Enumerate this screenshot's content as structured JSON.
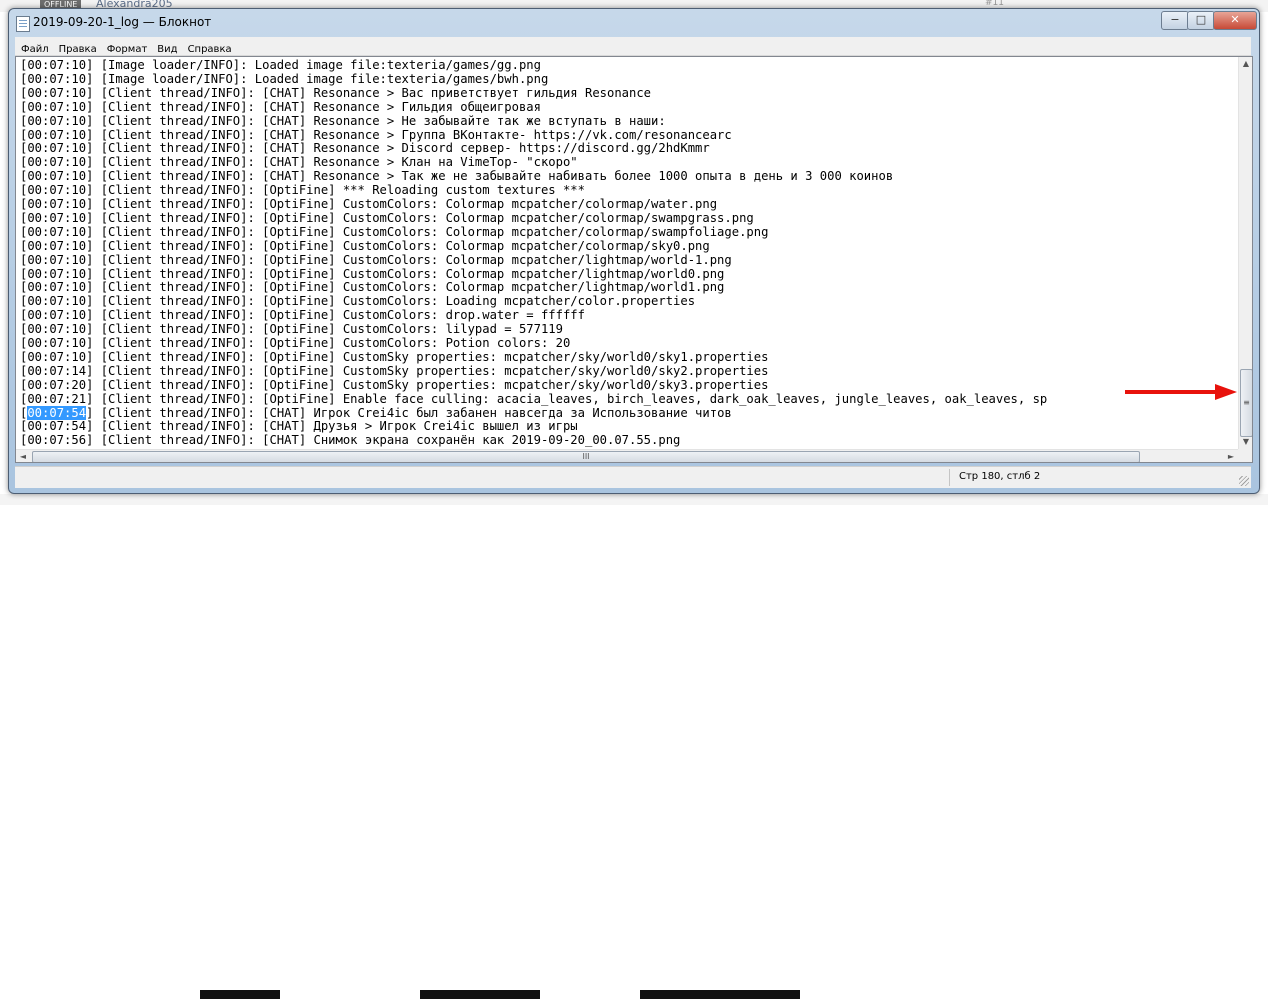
{
  "background": {
    "tag": "OFFLINE",
    "username": "Alexandra205",
    "post_number": "#11"
  },
  "window": {
    "title": "2019-09-20-1_log — Блокнот",
    "controls": {
      "minimize": "−",
      "maximize": "□",
      "close": "✕"
    }
  },
  "menu": [
    "Файл",
    "Правка",
    "Формат",
    "Вид",
    "Справка"
  ],
  "log_lines": [
    "[00:07:10] [Image loader/INFO]: Loaded image file:texteria/games/gg.png",
    "[00:07:10] [Image loader/INFO]: Loaded image file:texteria/games/bwh.png",
    "[00:07:10] [Client thread/INFO]: [CHAT] Resonance > Вас приветствует гильдия Resonance",
    "[00:07:10] [Client thread/INFO]: [CHAT] Resonance > Гильдия общеигровая",
    "[00:07:10] [Client thread/INFO]: [CHAT] Resonance > Не забывайте так же вступать в наши:",
    "[00:07:10] [Client thread/INFO]: [CHAT] Resonance > Группа ВКонтакте- https://vk.com/resonancearc",
    "[00:07:10] [Client thread/INFO]: [CHAT] Resonance > Discord сервер- https://discord.gg/2hdKmmr",
    "[00:07:10] [Client thread/INFO]: [CHAT] Resonance > Клан на VimeTop- \"скоро\"",
    "[00:07:10] [Client thread/INFO]: [CHAT] Resonance > Так же не забывайте набивать более 1000 опыта в день и 3 000 коинов",
    "[00:07:10] [Client thread/INFO]: [OptiFine] *** Reloading custom textures ***",
    "[00:07:10] [Client thread/INFO]: [OptiFine] CustomColors: Colormap mcpatcher/colormap/water.png",
    "[00:07:10] [Client thread/INFO]: [OptiFine] CustomColors: Colormap mcpatcher/colormap/swampgrass.png",
    "[00:07:10] [Client thread/INFO]: [OptiFine] CustomColors: Colormap mcpatcher/colormap/swampfoliage.png",
    "[00:07:10] [Client thread/INFO]: [OptiFine] CustomColors: Colormap mcpatcher/colormap/sky0.png",
    "[00:07:10] [Client thread/INFO]: [OptiFine] CustomColors: Colormap mcpatcher/lightmap/world-1.png",
    "[00:07:10] [Client thread/INFO]: [OptiFine] CustomColors: Colormap mcpatcher/lightmap/world0.png",
    "[00:07:10] [Client thread/INFO]: [OptiFine] CustomColors: Colormap mcpatcher/lightmap/world1.png",
    "[00:07:10] [Client thread/INFO]: [OptiFine] CustomColors: Loading mcpatcher/color.properties",
    "[00:07:10] [Client thread/INFO]: [OptiFine] CustomColors: drop.water = ffffff",
    "[00:07:10] [Client thread/INFO]: [OptiFine] CustomColors: lilypad = 577119",
    "[00:07:10] [Client thread/INFO]: [OptiFine] CustomColors: Potion colors: 20",
    "[00:07:10] [Client thread/INFO]: [OptiFine] CustomSky properties: mcpatcher/sky/world0/sky1.properties",
    "[00:07:14] [Client thread/INFO]: [OptiFine] CustomSky properties: mcpatcher/sky/world0/sky2.properties",
    "[00:07:20] [Client thread/INFO]: [OptiFine] CustomSky properties: mcpatcher/sky/world0/sky3.properties",
    "[00:07:21] [Client thread/INFO]: [OptiFine] Enable face culling: acacia_leaves, birch_leaves, dark_oak_leaves, jungle_leaves, oak_leaves, sp",
    "[00:07:54] [Client thread/INFO]: [CHAT] Игрок Crei4ic был забанен навсегда за Использование читов",
    "[00:07:54] [Client thread/INFO]: [CHAT] Друзья > Игрок Crei4ic вышел из игры",
    "[00:07:56] [Client thread/INFO]: [CHAT] Снимок экрана сохранён как 2019-09-20_00.07.55.png"
  ],
  "selected_text": "00:07:54",
  "selected_line_rest": "] [Client thread/INFO]: [CHAT] Игрок Crei4ic был забанен навсегда за Использование читов",
  "scrollbar": {
    "up": "▲",
    "down": "▼",
    "left": "◄",
    "right": "►",
    "grip": "≡",
    "hgrip": "III"
  },
  "status": {
    "position": "Стр 180, стлб 2"
  },
  "colors": {
    "selection": "#3399ff",
    "annotation_arrow": "#e8120c"
  }
}
